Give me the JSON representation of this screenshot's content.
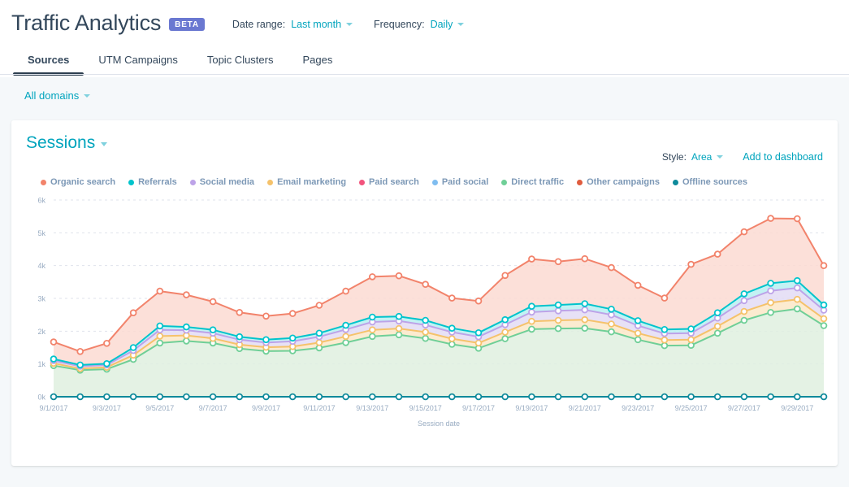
{
  "header": {
    "app_title": "Traffic Analytics",
    "beta_badge": "BETA",
    "date_range_label": "Date range:",
    "date_range_value": "Last month",
    "frequency_label": "Frequency:",
    "frequency_value": "Daily"
  },
  "tabs": [
    {
      "label": "Sources",
      "active": true
    },
    {
      "label": "UTM Campaigns",
      "active": false
    },
    {
      "label": "Topic Clusters",
      "active": false
    },
    {
      "label": "Pages",
      "active": false
    }
  ],
  "domain_filter": {
    "label": "All domains"
  },
  "card": {
    "metric_title": "Sessions",
    "style_label": "Style:",
    "style_value": "Area",
    "add_to_dashboard": "Add to dashboard"
  },
  "colors": {
    "accent_link": "#00a4bd",
    "text_dark": "#33475b",
    "beta_badge_bg": "#6a78d1",
    "active_tab_underline": "#2e3f50",
    "page_bg": "#f5f8fa",
    "legend_text": "#7c98b6",
    "gridline": "#dfe3eb"
  },
  "chart_data": {
    "type": "area",
    "stacked": true,
    "title": "Sessions",
    "xlabel": "Session date",
    "ylabel": "",
    "ylim": [
      0,
      6000
    ],
    "ytick_labels": [
      "0k",
      "1k",
      "2k",
      "3k",
      "4k",
      "5k",
      "6k"
    ],
    "ytick_values": [
      0,
      1000,
      2000,
      3000,
      4000,
      5000,
      6000
    ],
    "grid": true,
    "legend_position": "top-left",
    "x": [
      "9/1/2017",
      "9/2/2017",
      "9/3/2017",
      "9/4/2017",
      "9/5/2017",
      "9/6/2017",
      "9/7/2017",
      "9/8/2017",
      "9/9/2017",
      "9/10/2017",
      "9/11/2017",
      "9/12/2017",
      "9/13/2017",
      "9/14/2017",
      "9/15/2017",
      "9/16/2017",
      "9/17/2017",
      "9/18/2017",
      "9/19/2017",
      "9/20/2017",
      "9/21/2017",
      "9/22/2017",
      "9/23/2017",
      "9/24/2017",
      "9/25/2017",
      "9/26/2017",
      "9/27/2017",
      "9/28/2017",
      "9/29/2017",
      "9/30/2017"
    ],
    "xtick_labels": [
      "9/1/2017",
      "9/3/2017",
      "9/5/2017",
      "9/7/2017",
      "9/9/2017",
      "9/11/2017",
      "9/13/2017",
      "9/15/2017",
      "9/17/2017",
      "9/19/2017",
      "9/21/2017",
      "9/23/2017",
      "9/25/2017",
      "9/27/2017",
      "9/29/2017"
    ],
    "series": [
      {
        "name": "Offline sources",
        "color": "#0e8a9b",
        "fill": "#0e8a9b",
        "values": [
          0,
          0,
          0,
          0,
          0,
          0,
          0,
          0,
          0,
          0,
          0,
          0,
          0,
          0,
          0,
          0,
          0,
          0,
          0,
          0,
          0,
          0,
          0,
          0,
          0,
          0,
          0,
          0,
          0,
          0
        ]
      },
      {
        "name": "Direct traffic",
        "color": "#6fcf97",
        "fill": "#dff0df",
        "values": [
          950,
          810,
          840,
          1140,
          1640,
          1700,
          1640,
          1470,
          1390,
          1400,
          1490,
          1650,
          1840,
          1890,
          1780,
          1600,
          1480,
          1770,
          2060,
          2080,
          2090,
          1980,
          1740,
          1560,
          1570,
          1940,
          2330,
          2570,
          2680,
          2170
        ]
      },
      {
        "name": "Email marketing",
        "color": "#f5c26b",
        "fill": "#fbe7c8",
        "values": [
          70,
          50,
          60,
          130,
          210,
          170,
          140,
          120,
          120,
          130,
          160,
          190,
          200,
          190,
          190,
          170,
          160,
          200,
          240,
          250,
          260,
          240,
          200,
          170,
          170,
          210,
          270,
          300,
          290,
          210
        ]
      },
      {
        "name": "Paid search",
        "color": "#f2547d",
        "fill": "#fbd2dd",
        "values": [
          0,
          0,
          0,
          0,
          0,
          0,
          0,
          0,
          0,
          0,
          0,
          0,
          0,
          0,
          0,
          0,
          0,
          0,
          0,
          0,
          0,
          0,
          0,
          0,
          0,
          0,
          0,
          0,
          0,
          0
        ]
      },
      {
        "name": "Paid social",
        "color": "#7fbdf0",
        "fill": "#d8e9fa",
        "values": [
          0,
          0,
          0,
          0,
          0,
          0,
          0,
          0,
          0,
          0,
          0,
          0,
          0,
          0,
          0,
          0,
          0,
          0,
          0,
          0,
          0,
          0,
          0,
          0,
          0,
          0,
          0,
          0,
          0,
          0
        ]
      },
      {
        "name": "Social media",
        "color": "#bda3e8",
        "fill": "#e3dcf4",
        "values": [
          80,
          70,
          70,
          140,
          190,
          160,
          160,
          150,
          140,
          160,
          180,
          210,
          240,
          230,
          220,
          200,
          190,
          230,
          280,
          290,
          300,
          280,
          230,
          200,
          200,
          250,
          330,
          360,
          350,
          260
        ]
      },
      {
        "name": "Referrals",
        "color": "#00c4cc",
        "fill": "#b8f0f2",
        "values": [
          50,
          40,
          40,
          90,
          120,
          100,
          100,
          90,
          90,
          100,
          110,
          130,
          150,
          140,
          140,
          120,
          120,
          150,
          180,
          180,
          190,
          170,
          150,
          120,
          130,
          160,
          210,
          230,
          220,
          160
        ]
      },
      {
        "name": "Other campaigns",
        "color": "#e05c3e",
        "fill": "#f7cfc5",
        "values": [
          0,
          0,
          0,
          0,
          0,
          0,
          0,
          0,
          0,
          0,
          0,
          0,
          0,
          0,
          0,
          0,
          0,
          0,
          0,
          0,
          0,
          0,
          0,
          0,
          0,
          0,
          0,
          0,
          0,
          0
        ]
      },
      {
        "name": "Organic search",
        "color": "#f2836b",
        "fill": "#fbdad2",
        "values": [
          520,
          410,
          620,
          1060,
          1060,
          980,
          860,
          740,
          720,
          750,
          850,
          1040,
          1230,
          1240,
          1100,
          920,
          970,
          1350,
          1440,
          1320,
          1370,
          1270,
          1080,
          960,
          1970,
          1790,
          1890,
          1980,
          1890,
          1200
        ]
      }
    ],
    "legend": [
      {
        "name": "Organic search",
        "color": "#f2836b"
      },
      {
        "name": "Referrals",
        "color": "#00c4cc"
      },
      {
        "name": "Social media",
        "color": "#bda3e8"
      },
      {
        "name": "Email marketing",
        "color": "#f5c26b"
      },
      {
        "name": "Paid search",
        "color": "#f2547d"
      },
      {
        "name": "Paid social",
        "color": "#7fbdf0"
      },
      {
        "name": "Direct traffic",
        "color": "#6fcf97"
      },
      {
        "name": "Other campaigns",
        "color": "#e05c3e"
      },
      {
        "name": "Offline sources",
        "color": "#0e8a9b"
      }
    ],
    "stack_order_bottom_to_top": [
      "Offline sources",
      "Direct traffic",
      "Email marketing",
      "Social media",
      "Referrals",
      "Organic search"
    ]
  }
}
